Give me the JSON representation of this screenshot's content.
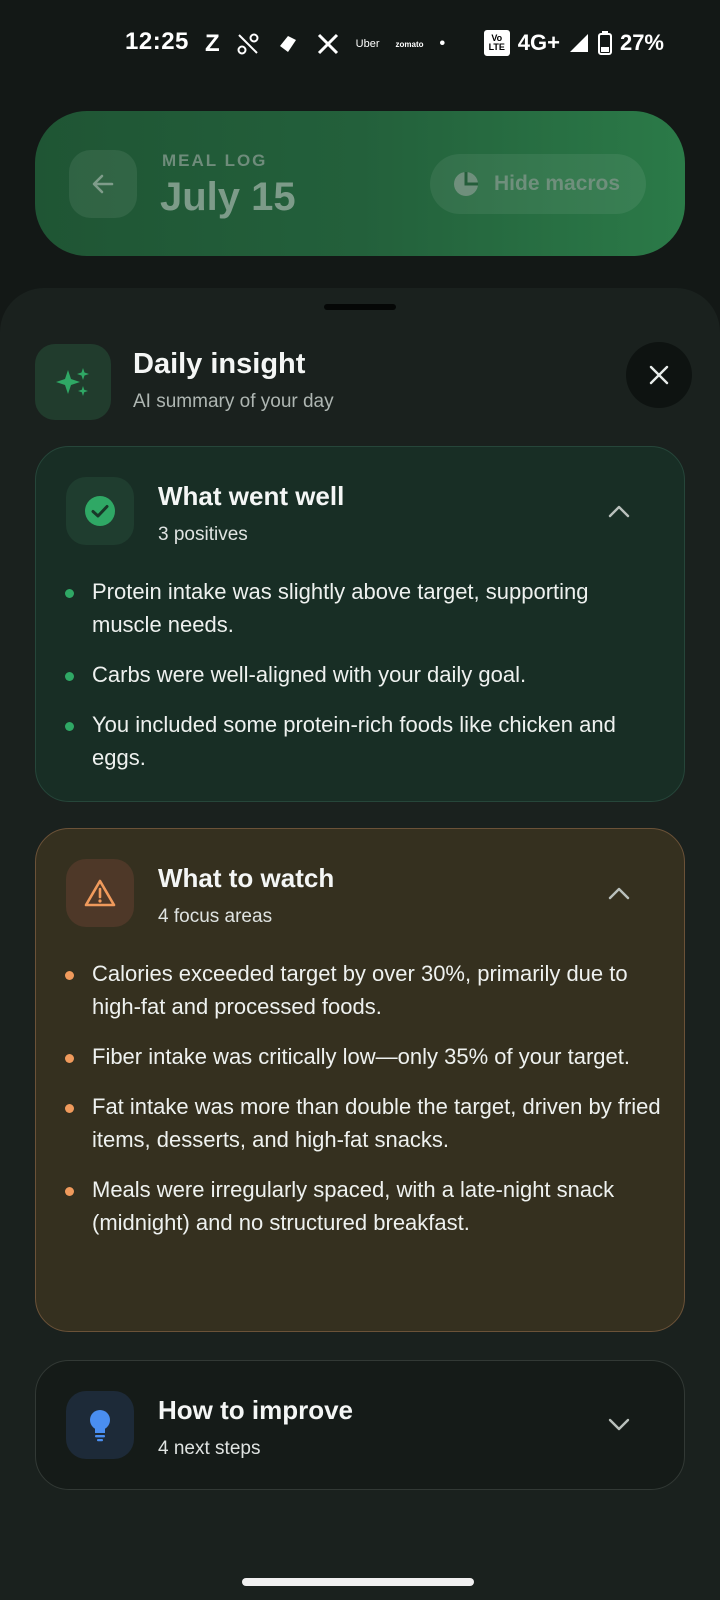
{
  "status_bar": {
    "time": "12:25",
    "app_icons": [
      "Z",
      "Uber",
      "zomato",
      "•"
    ],
    "volte": "Vo LTE",
    "network": "4G+",
    "battery": "27%"
  },
  "header": {
    "eyebrow": "MEAL LOG",
    "title": "July 15",
    "macros_button": "Hide macros"
  },
  "insight": {
    "title": "Daily insight",
    "subtitle": "AI summary of your day"
  },
  "sections": {
    "well": {
      "title": "What went well",
      "count": "3 positives",
      "items": [
        "Protein intake was slightly above target, supporting muscle needs.",
        "Carbs were well-aligned with your daily goal.",
        "You included some protein-rich foods like chicken and eggs."
      ]
    },
    "watch": {
      "title": "What to watch",
      "count": "4 focus areas",
      "items": [
        "Calories exceeded target by over 30%, primarily due to high-fat and processed foods.",
        "Fiber intake was critically low—only 35% of your target.",
        "Fat intake was more than double the target, driven by fried items, desserts, and high-fat snacks.",
        "Meals were irregularly spaced, with a late-night snack (midnight) and no structured breakfast."
      ]
    },
    "improve": {
      "title": "How to improve",
      "count": "4 next steps"
    }
  },
  "colors": {
    "accent_green": "#2fa865",
    "accent_orange": "#f09a5c",
    "accent_blue": "#4a8ef0"
  }
}
